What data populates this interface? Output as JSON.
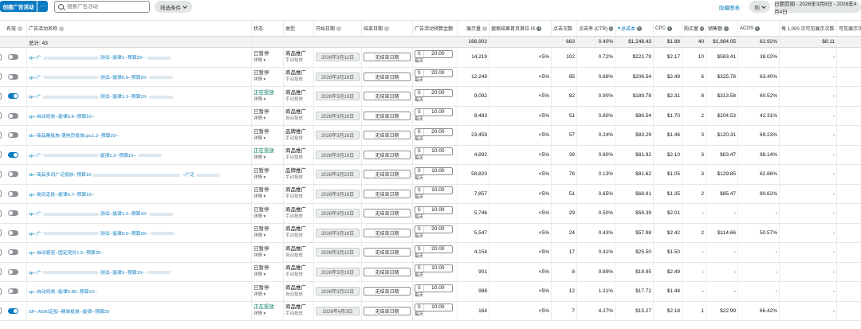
{
  "toolbar": {
    "create_label": "创建广告活动",
    "more_label": "···",
    "search_placeholder": "搜索广告活动",
    "filter_label": "筛选条件",
    "hide_chart_label": "隐藏图表",
    "columns_label": "列",
    "date_range_label": "日期范围 - 2026年3月8日 - 2026年4月4日"
  },
  "headers": {
    "active": "有效",
    "name": "广告活动名称",
    "status": "状态",
    "type": "类型",
    "start": "开始日期",
    "end": "结束日期",
    "budget": "广告活动预算金额",
    "impressions": "展示量",
    "top_is": "搜索结果首页首位 IS",
    "clicks": "点击次数",
    "ctr": "点击率 (CTR)",
    "spend": "总成本",
    "cpc": "CPC",
    "orders": "购买量",
    "sales": "销售额",
    "acos": "ACOS",
    "vcpm": "每 1,000 次可见展示次数",
    "visible": "可见展示次"
  },
  "totals": {
    "label": "总计: 43",
    "impressions": "166,902",
    "clicks": "663",
    "ctr": "0.40%",
    "spend": "$1,248.43",
    "cpc": "$1.88",
    "orders": "40",
    "sales": "$1,984.05",
    "acos": "62.92%",
    "vcpm": "$8.11"
  },
  "common": {
    "detail": "详情",
    "end_date": "无结束日期",
    "currency": "$",
    "per_day": "每天",
    "top_is": "<5%"
  },
  "rows": [
    {
      "on": false,
      "prefix": "sp--广",
      "mid": "测试--旋律1--预算20--",
      "status": "已暂停",
      "type": "商品推广",
      "targeting": "手动投放",
      "start": "2026年3月12日",
      "budget": "20.00",
      "impressions": "14,219",
      "clicks": "102",
      "ctr": "0.72%",
      "spend": "$221.79",
      "cpc": "$2.17",
      "orders": "10",
      "sales": "$583.41",
      "acos": "38.02%",
      "vcpm": "-"
    },
    {
      "on": false,
      "prefix": "sp--广",
      "mid": "测试--旋律0.9--预算20-",
      "status": "已暂停",
      "type": "商品推广",
      "targeting": "手动投放",
      "start": "2026年3月16日",
      "budget": "20.00",
      "impressions": "12,249",
      "clicks": "85",
      "ctr": "0.68%",
      "spend": "$206.54",
      "cpc": "$2.49",
      "orders": "6",
      "sales": "$325.78",
      "acos": "63.40%",
      "vcpm": "-"
    },
    {
      "on": true,
      "prefix": "sp--广",
      "mid": "测试--旋律1.1--预算20-",
      "status": "正在投放",
      "type": "商品推广",
      "targeting": "手动投放",
      "start": "2026年3月19日",
      "budget": "20.00",
      "impressions": "9,092",
      "clicks": "82",
      "ctr": "0.90%",
      "spend": "$189.78",
      "cpc": "$2.31",
      "orders": "8",
      "sales": "$313.58",
      "acos": "60.52%",
      "vcpm": "-"
    },
    {
      "on": false,
      "prefix": "sp--自动同类--旋律0.8--预算10--",
      "mid": "",
      "status": "已暂停",
      "type": "商品推广",
      "targeting": "自动投放",
      "start": "2026年3月16日",
      "budget": "10.00",
      "impressions": "8,483",
      "clicks": "51",
      "ctr": "0.60%",
      "spend": "$86.54",
      "cpc": "$1.70",
      "orders": "2",
      "sales": "$204.53",
      "acos": "42.31%",
      "vcpm": "-"
    },
    {
      "on": false,
      "prefix": "sb--商品集投放-落地页投放cpc1.2--预算20--",
      "mid": "",
      "status": "已暂停",
      "type": "品牌推广",
      "targeting": "手动投放",
      "start": "2026年3月16日",
      "budget": "20.00",
      "impressions": "23,459",
      "clicks": "57",
      "ctr": "0.24%",
      "spend": "$83.29",
      "cpc": "$1.46",
      "orders": "3",
      "sales": "$120.31",
      "acos": "69.23%",
      "vcpm": "-"
    },
    {
      "on": true,
      "prefix": "sp--广",
      "mid": "旋律1.2--预算10--",
      "status": "正在投放",
      "type": "商品推广",
      "targeting": "手动投放",
      "start": "2026年3月19日",
      "budget": "10.00",
      "impressions": "4,892",
      "clicks": "39",
      "ctr": "0.80%",
      "spend": "$81.92",
      "cpc": "$2.10",
      "orders": "3",
      "sales": "$83.47",
      "acos": "98.14%",
      "vcpm": "-"
    },
    {
      "on": false,
      "prefix": "sb--商品多词广泛投放--预算10",
      "mid": "--广泛",
      "status": "已暂停",
      "type": "品牌推广",
      "targeting": "手动投放",
      "start": "2026年3月23日",
      "budget": "10.00",
      "impressions": "58,820",
      "clicks": "78",
      "ctr": "0.13%",
      "spend": "$81.62",
      "cpc": "$1.05",
      "orders": "3",
      "sales": "$129.85",
      "acos": "62.86%",
      "vcpm": "-"
    },
    {
      "on": false,
      "prefix": "sp--类目定投--旋律0.7--预算10--",
      "mid": "",
      "status": "已暂停",
      "type": "商品推广",
      "targeting": "手动投放",
      "start": "2026年3月16日",
      "budget": "10.00",
      "impressions": "7,857",
      "clicks": "51",
      "ctr": "0.65%",
      "spend": "$68.91",
      "cpc": "$1.35",
      "orders": "2",
      "sales": "$85.47",
      "acos": "80.62%",
      "vcpm": "-"
    },
    {
      "on": false,
      "prefix": "sp--广",
      "mid": "测试--旋律1.2--预算10-",
      "status": "已暂停",
      "type": "商品推广",
      "targeting": "手动投放",
      "start": "2026年3月19日",
      "budget": "10.00",
      "impressions": "5,746",
      "clicks": "29",
      "ctr": "0.50%",
      "spend": "$58.39",
      "cpc": "$2.01",
      "orders": "-",
      "sales": "-",
      "acos": "-",
      "vcpm": "-"
    },
    {
      "on": false,
      "prefix": "sp--广",
      "mid": "测试--旋律0.9--预算20--",
      "status": "已暂停",
      "type": "商品推广",
      "targeting": "手动投放",
      "start": "2026年3月16日",
      "budget": "20.00",
      "impressions": "5,547",
      "clicks": "24",
      "ctr": "0.43%",
      "spend": "$57.98",
      "cpc": "$2.42",
      "orders": "2",
      "sales": "$114.66",
      "acos": "50.57%",
      "vcpm": "-"
    },
    {
      "on": false,
      "prefix": "sp--自动紧密--固定竞价1.5--预算20--",
      "mid": "",
      "status": "已暂停",
      "type": "商品推广",
      "targeting": "自动投放",
      "start": "2026年3月12日",
      "budget": "20.00",
      "impressions": "4,154",
      "clicks": "17",
      "ctr": "0.41%",
      "spend": "$25.50",
      "cpc": "$1.50",
      "orders": "-",
      "sales": "-",
      "acos": "-",
      "vcpm": "-"
    },
    {
      "on": false,
      "prefix": "sp--广",
      "mid": "测试--旋律1--预算10--",
      "status": "已暂停",
      "type": "商品推广",
      "targeting": "手动投放",
      "start": "2026年3月19日",
      "budget": "10.00",
      "impressions": "901",
      "clicks": "8",
      "ctr": "0.89%",
      "spend": "$19.95",
      "cpc": "$2.49",
      "orders": "-",
      "sales": "-",
      "acos": "-",
      "vcpm": "-"
    },
    {
      "on": false,
      "prefix": "sp--自动同类--旋律0.85--预算10--",
      "mid": "",
      "status": "已暂停",
      "type": "商品推广",
      "targeting": "自动投放",
      "start": "2026年3月22日",
      "budget": "10.00",
      "impressions": "988",
      "clicks": "12",
      "ctr": "1.21%",
      "spend": "$17.72",
      "cpc": "$1.48",
      "orders": "-",
      "sales": "-",
      "acos": "-",
      "vcpm": "-"
    },
    {
      "on": true,
      "prefix": "SP--ASIN定投--精准投放--旋律--预算20",
      "mid": "",
      "status": "正在投放",
      "type": "商品推广",
      "targeting": "手动投放",
      "start": "2026年4月3日",
      "budget": "10.00",
      "impressions": "164",
      "clicks": "7",
      "ctr": "4.27%",
      "spend": "$15.27",
      "cpc": "$2.18",
      "orders": "1",
      "sales": "$22.99",
      "acos": "66.42%",
      "vcpm": "-"
    }
  ]
}
